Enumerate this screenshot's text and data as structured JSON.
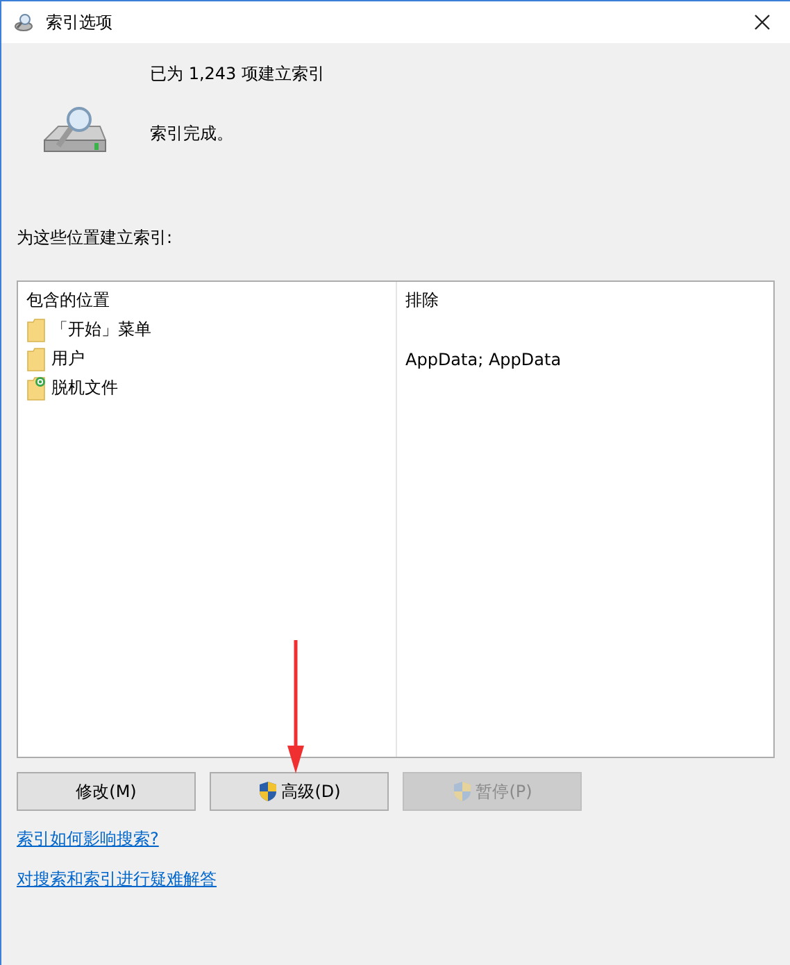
{
  "window": {
    "title": "索引选项"
  },
  "status": {
    "count_line": "已为 1,243 项建立索引",
    "state_line": "索引完成。"
  },
  "locations_label": "为这些位置建立索引:",
  "table": {
    "columns": [
      "包含的位置",
      "排除"
    ],
    "rows": [
      {
        "kind": "folder",
        "location": "「开始」菜单",
        "exclude": ""
      },
      {
        "kind": "folder",
        "location": "用户",
        "exclude": "AppData; AppData"
      },
      {
        "kind": "offline",
        "location": "脱机文件",
        "exclude": ""
      }
    ]
  },
  "buttons": [
    {
      "label": "修改(M)",
      "shield": false,
      "disabled": false
    },
    {
      "label": "高级(D)",
      "shield": true,
      "disabled": false
    },
    {
      "label": "暂停(P)",
      "shield": true,
      "disabled": true
    }
  ],
  "links": [
    "索引如何影响搜索?",
    "对搜索和索引进行疑难解答"
  ]
}
